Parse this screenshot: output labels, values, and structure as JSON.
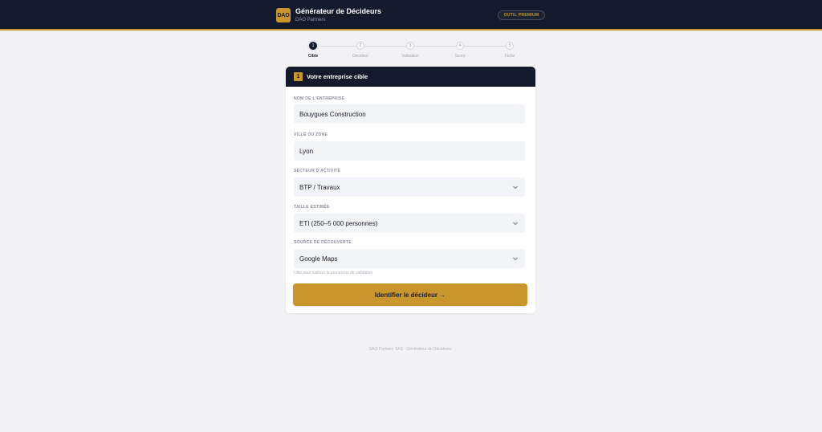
{
  "header": {
    "logo_text": "DAO",
    "title": "Générateur de Décideurs",
    "subtitle": "DAO Partners",
    "premium_label": "OUTIL PREMIUM",
    "accent_color": "#c9962e",
    "background_color": "#121a2b"
  },
  "stepper": {
    "steps": [
      {
        "number": "1",
        "label": "Cible",
        "active": true
      },
      {
        "number": "2",
        "label": "Décideur",
        "active": false
      },
      {
        "number": "3",
        "label": "Validation",
        "active": false
      },
      {
        "number": "4",
        "label": "Score",
        "active": false
      },
      {
        "number": "5",
        "label": "Fiche",
        "active": false
      }
    ]
  },
  "card": {
    "step_number": "1",
    "title": "Votre entreprise cible",
    "fields": [
      {
        "label": "NOM DE L'ENTREPRISE",
        "value": "Bouygues Construction",
        "type": "text"
      },
      {
        "label": "VILLE OU ZONE",
        "value": "Lyon",
        "type": "text"
      },
      {
        "label": "SECTEUR D'ACTIVITÉ",
        "value": "BTP / Travaux",
        "type": "select"
      },
      {
        "label": "TAILLE ESTIMÉE",
        "value": "ETI (250–5 000 personnes)",
        "type": "select"
      },
      {
        "label": "SOURCE DE DÉCOUVERTE",
        "value": "Google Maps",
        "type": "select"
      }
    ],
    "hint": "Utile pour calibrer le processus de validation",
    "submit_label": "Identifier le décideur →"
  },
  "footer": {
    "text": "DAO Partners SAS · Générateur de Décideurs"
  }
}
